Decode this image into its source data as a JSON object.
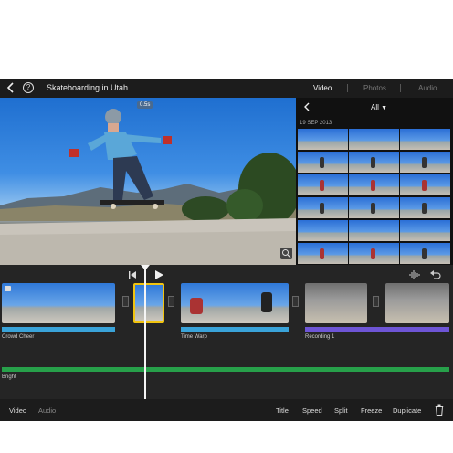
{
  "app": {
    "project_title": "Skateboarding in Utah",
    "help_glyph": "?",
    "back_icon": "chevron-left-icon",
    "tabs": [
      {
        "label": "Video",
        "active": true
      },
      {
        "label": "Photos",
        "active": false
      },
      {
        "label": "Audio",
        "active": false
      }
    ]
  },
  "viewer": {
    "time_badge": "0.5s",
    "zoom_icon": "zoom-icon"
  },
  "browser": {
    "filter_label": "All",
    "date_header": "19 SEP 2013"
  },
  "timeline": {
    "tracks": {
      "clip_track_1_label": "Crowd Cheer",
      "clip_track_2_label": "Time Warp",
      "clip_track_3_label": "Recording 1",
      "music_track_label": "Bright"
    },
    "colors": {
      "clip_audio": "#3aa3d9",
      "recording": "#6e55d6",
      "music": "#27a04a",
      "selection": "#f1c40f"
    }
  },
  "bottom_bar": {
    "left_tabs": [
      {
        "label": "Video",
        "active": true
      },
      {
        "label": "Audio",
        "active": false
      }
    ],
    "actions": [
      "Title",
      "Speed",
      "Split",
      "Freeze",
      "Duplicate"
    ]
  }
}
